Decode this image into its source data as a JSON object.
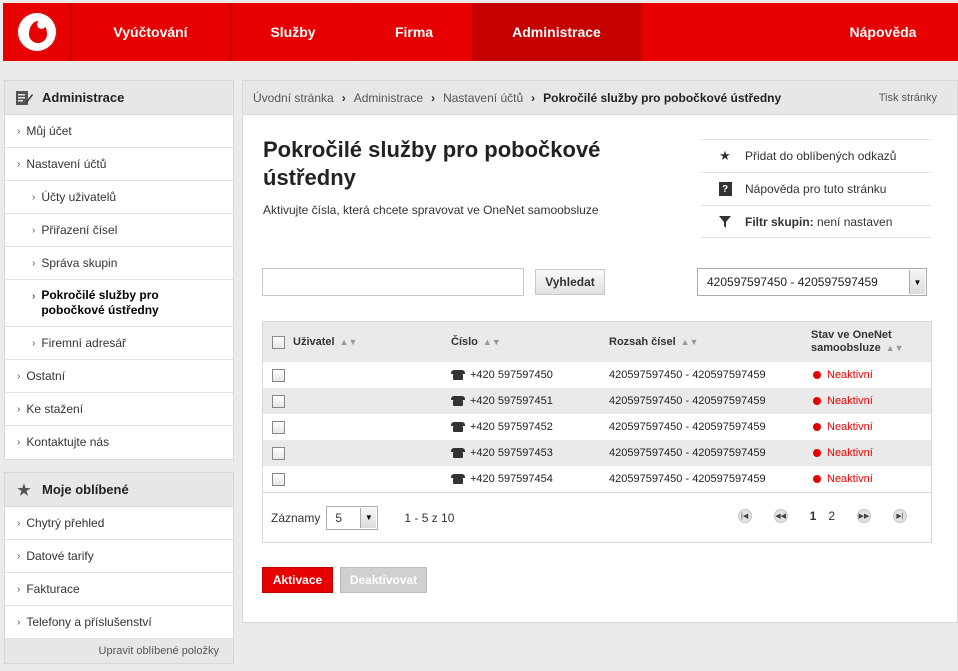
{
  "nav": {
    "items": [
      {
        "label": "Vyúčtování",
        "width": 160,
        "active": false
      },
      {
        "label": "Služby",
        "width": 125,
        "active": false
      },
      {
        "label": "Firma",
        "width": 117,
        "active": false
      },
      {
        "label": "Administrace",
        "width": 168,
        "active": true
      }
    ],
    "help": "Nápověda"
  },
  "sidebar": {
    "admin_title": "Administrace",
    "items": [
      {
        "label": "Můj účet",
        "sub": false,
        "selected": false
      },
      {
        "label": "Nastavení účtů",
        "sub": false,
        "selected": false
      },
      {
        "label": "Účty uživatelů",
        "sub": true,
        "selected": false
      },
      {
        "label": "Přiřazení čísel",
        "sub": true,
        "selected": false
      },
      {
        "label": "Správa skupin",
        "sub": true,
        "selected": false
      },
      {
        "label": "Pokročilé služby pro pobočkové ústředny",
        "sub": true,
        "selected": true
      },
      {
        "label": "Firemní adresář",
        "sub": true,
        "selected": false
      },
      {
        "label": "Ostatní",
        "sub": false,
        "selected": false
      },
      {
        "label": "Ke stažení",
        "sub": false,
        "selected": false
      },
      {
        "label": "Kontaktujte nás",
        "sub": false,
        "selected": false
      }
    ],
    "fav_title": "Moje oblíbené",
    "fav_items": [
      "Chytrý přehled",
      "Datové tarify",
      "Fakturace",
      "Telefony a příslušenství"
    ],
    "fav_edit": "Upravit oblíbené položky"
  },
  "breadcrumb": {
    "items": [
      "Úvodní stránka",
      "Administrace",
      "Nastavení účtů"
    ],
    "current": "Pokročilé služby pro pobočkové ústředny",
    "print": "Tisk stránky"
  },
  "page": {
    "title": "Pokročilé služby pro pobočkové ústředny",
    "description": "Aktivujte čísla, která chcete spravovat ve OneNet samoobsluze"
  },
  "actions": {
    "favorite": "Přidat do oblíbených odkazů",
    "help": "Nápověda pro tuto stránku",
    "filter_label": "Filtr skupin:",
    "filter_value": " není nastaven"
  },
  "search": {
    "value": "",
    "button": "Vyhledat"
  },
  "range_select": "420597597450 - 420597597459",
  "table": {
    "headers": {
      "user": "Uživatel",
      "number": "Číslo",
      "range": "Rozsah čísel",
      "status": "Stav ve OneNet samoobsluze"
    },
    "rows": [
      {
        "user": "",
        "number": "+420 597597450",
        "range": "420597597450 - 420597597459",
        "status": "Neaktivní"
      },
      {
        "user": "",
        "number": "+420 597597451",
        "range": "420597597450 - 420597597459",
        "status": "Neaktivní"
      },
      {
        "user": "",
        "number": "+420 597597452",
        "range": "420597597450 - 420597597459",
        "status": "Neaktivní"
      },
      {
        "user": "",
        "number": "+420 597597453",
        "range": "420597597450 - 420597597459",
        "status": "Neaktivní"
      },
      {
        "user": "",
        "number": "+420 597597454",
        "range": "420597597450 - 420597597459",
        "status": "Neaktivní"
      }
    ],
    "records_label": "Záznamy",
    "page_size": "5",
    "count": "1 - 5 z 10",
    "pages": [
      "1",
      "2"
    ],
    "current_page": "1"
  },
  "buttons": {
    "activate": "Aktivace",
    "deactivate": "Deaktivovat"
  },
  "colors": {
    "brand": "#e60000",
    "brand_dark": "#c40000",
    "status_inactive": "#e60000"
  }
}
